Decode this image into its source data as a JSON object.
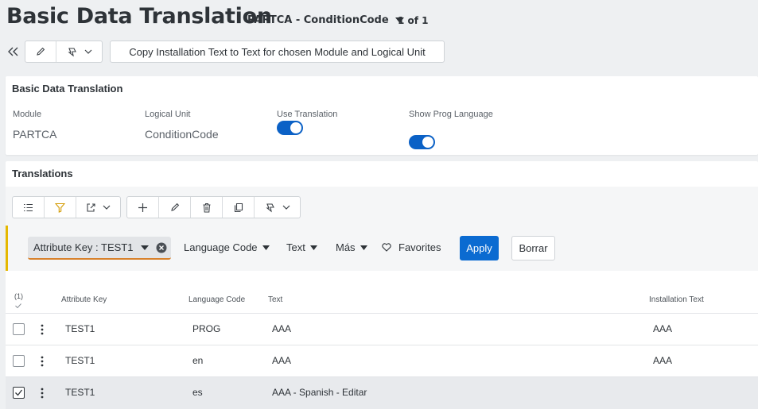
{
  "header": {
    "title": "Basic Data Translation",
    "record_selector": "PARTCA - ConditionCode",
    "record_count": "1 of 1"
  },
  "toolbar": {
    "copy_label": "Copy Installation Text to Text for chosen Module and Logical Unit"
  },
  "basic_panel": {
    "title": "Basic Data Translation",
    "module_label": "Module",
    "module_value": "PARTCA",
    "lu_label": "Logical Unit",
    "lu_value": "ConditionCode",
    "use_translation_label": "Use Translation",
    "use_translation_on": true,
    "show_prog_label": "Show Prog Language",
    "show_prog_on": true
  },
  "translations_panel": {
    "title": "Translations"
  },
  "filter": {
    "chip_label": "Attribute Key : TEST1",
    "language_code": "Language Code",
    "text": "Text",
    "more": "Más",
    "favorites": "Favorites",
    "apply": "Apply",
    "clear": "Borrar"
  },
  "table": {
    "selected_count": "(1)",
    "columns": {
      "attribute_key": "Attribute Key",
      "language_code": "Language Code",
      "text": "Text",
      "installation_text": "Installation Text"
    },
    "rows": [
      {
        "attribute_key": "TEST1",
        "language_code": "PROG",
        "text": "AAA",
        "installation_text": "AAA",
        "checked": false
      },
      {
        "attribute_key": "TEST1",
        "language_code": "en",
        "text": "AAA",
        "installation_text": "AAA",
        "checked": false
      },
      {
        "attribute_key": "TEST1",
        "language_code": "es",
        "text": "AAA - Spanish - Editar",
        "installation_text": "",
        "checked": true
      }
    ]
  },
  "colors": {
    "accent": "#0b6bd1",
    "toggle": "#0b61c6",
    "filter_marker": "#e5b800",
    "chip_underline": "#d8812b"
  }
}
